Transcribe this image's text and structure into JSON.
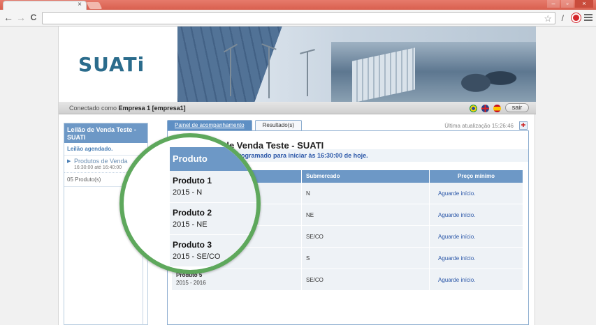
{
  "browser": {
    "tab_close": "×",
    "back": "←",
    "forward": "→",
    "reload": "C",
    "win_min": "–",
    "win_max": "▫",
    "win_close": "×",
    "star": "☆",
    "wrench": "/"
  },
  "header": {
    "logo": "SUATi",
    "conectado_label": "Conectado como",
    "user": "Empresa 1 [empresa1]",
    "sair": "sair"
  },
  "sidebar": {
    "leilao": "Leilão de Venda Teste - SUATI",
    "status": "Leilão agendado.",
    "produtos_label": "Produtos de Venda",
    "produtos_time": "16:30:00 até 16:40:00",
    "count": "05 Produto(s)"
  },
  "main": {
    "tabs": [
      {
        "label": "Painel de acompanhamento"
      },
      {
        "label": "Resultado(s)"
      }
    ],
    "last_update": "Última atualização 15:26:46",
    "title": "de Venda Teste - SUATI",
    "schedule": "programado para iniciar às 16:30:00 de hoje.",
    "columns": {
      "produto": "",
      "submercado": "Submercado",
      "preco": "Preço mínimo"
    },
    "rows": [
      {
        "produto": "",
        "ano": "",
        "submercado": "N",
        "preco": "Aguarde início."
      },
      {
        "produto": "",
        "ano": "",
        "submercado": "NE",
        "preco": "Aguarde início."
      },
      {
        "produto": "",
        "ano": "",
        "submercado": "SE/CO",
        "preco": "Aguarde início."
      },
      {
        "produto": "",
        "ano": "",
        "submercado": "S",
        "preco": "Aguarde início."
      },
      {
        "produto": "Produto 5",
        "ano": "2015 - 2016",
        "submercado": "SE/CO",
        "preco": "Aguarde início."
      }
    ]
  },
  "magnifier": {
    "header": "Produto",
    "rows": [
      {
        "produto": "Produto 1",
        "ano": "2015 - N"
      },
      {
        "produto": "Produto 2",
        "ano": "2015 - NE"
      },
      {
        "produto": "Produto 3",
        "ano": "2015 - SE/CO"
      }
    ]
  }
}
